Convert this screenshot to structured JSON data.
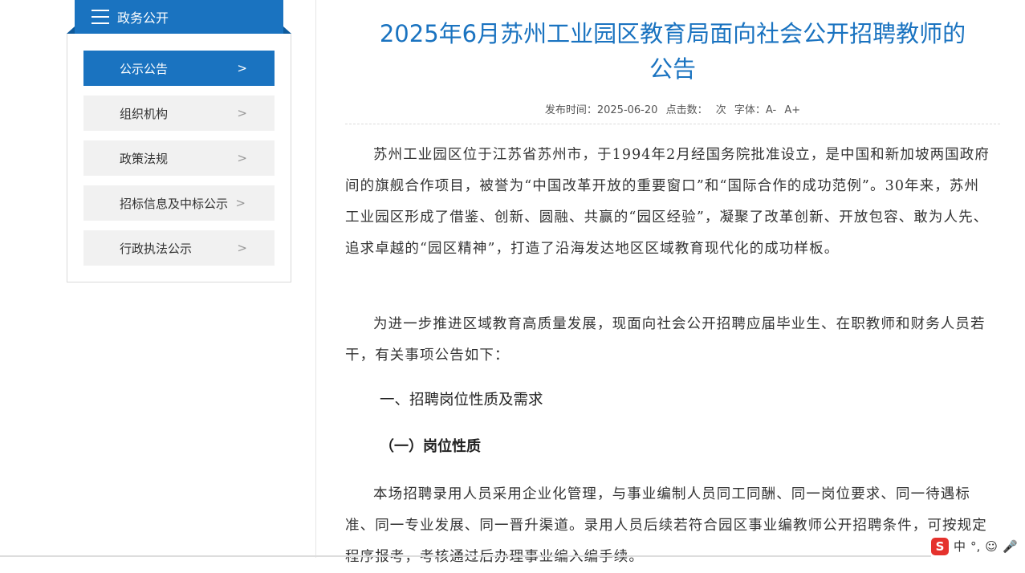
{
  "sidebar": {
    "title": "政务公开",
    "items": [
      {
        "label": "公示公告",
        "active": true
      },
      {
        "label": "组织机构",
        "active": false
      },
      {
        "label": "政策法规",
        "active": false
      },
      {
        "label": "招标信息及中标公示",
        "active": false
      },
      {
        "label": "行政执法公示",
        "active": false
      }
    ],
    "chevron": ">"
  },
  "article": {
    "title_line1": "2025年6月苏州工业园区教育局面向社会公开招聘教师的",
    "title_line2": "公告",
    "meta": {
      "publish_label": "发布时间：2025-06-20",
      "clicks_label": "点击数：",
      "clicks_unit": "次",
      "font_label": "字体：",
      "font_small": "A-",
      "font_large": "A+"
    },
    "paragraph1": "苏州工业园区位于江苏省苏州市，于1994年2月经国务院批准设立，是中国和新加坡两国政府间的旗舰合作项目，被誉为“中国改革开放的重要窗口”和“国际合作的成功范例”。30年来，苏州工业园区形成了借鉴、创新、圆融、共赢的“园区经验”，凝聚了改革创新、开放包容、敢为人先、追求卓越的“园区精神”，打造了沿海发达地区区域教育现代化的成功样板。",
    "paragraph2": "为进一步推进区域教育高质量发展，现面向社会公开招聘应届毕业生、在职教师和财务人员若干，有关事项公告如下：",
    "heading1": "一、招聘岗位性质及需求",
    "heading2": "（一）岗位性质",
    "paragraph3": "本场招聘录用人员采用企业化管理，与事业编制人员同工同酬、同一岗位要求、同一待遇标准、同一专业发展、同一晋升渠道。录用人员后续若符合园区事业编教师公开招聘条件，可按规定程序报考，考核通过后办理事业编入编手续。"
  },
  "ime": {
    "logo": "S",
    "mode": "中",
    "punct": "°,"
  },
  "colors": {
    "accent": "#1a73c0"
  }
}
